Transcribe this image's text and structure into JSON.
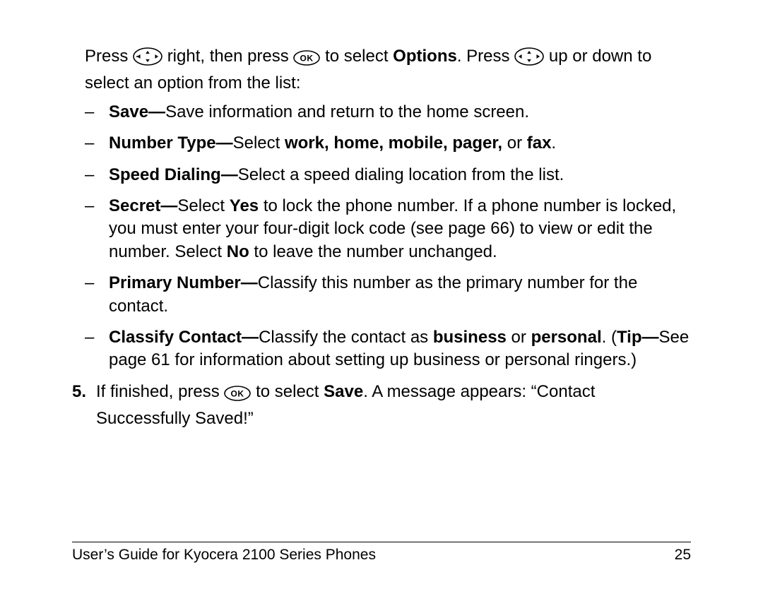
{
  "intro": {
    "p1": "Press ",
    "p2": " right, then press ",
    "p3": " to select ",
    "options": "Options",
    "p4": ". Press ",
    "p5": " up or down to select an option from the list:"
  },
  "bullets": {
    "save": {
      "t": "Save—",
      "d": "Save information and return to the home screen."
    },
    "numtype": {
      "t": "Number Type—",
      "d1": "Select ",
      "d2": "work, home, mobile, pager,",
      "d3": " or ",
      "d4": "fax",
      "d5": "."
    },
    "speed": {
      "t": "Speed Dialing—",
      "d": "Select a speed dialing location from the list."
    },
    "secret": {
      "t": "Secret—",
      "d1": "Select ",
      "yes": "Yes",
      "d2": " to lock the phone number. If a phone number is locked, you must enter your four-digit lock code (see page 66) to view or edit the number. Select ",
      "no": "No",
      "d3": " to leave the number unchanged."
    },
    "primary": {
      "t": "Primary Number—",
      "d": "Classify this number as the primary number for the contact."
    },
    "classify": {
      "t": "Classify Contact—",
      "d1": "Classify the contact as ",
      "biz": "business",
      "d2": " or ",
      "per": "personal",
      "d3": ". (",
      "tip": "Tip—",
      "d4": "See page 61 for information about setting up business or personal ringers.)"
    }
  },
  "step5": {
    "num": "5.",
    "p1": "If finished, press ",
    "p2": " to select ",
    "save": "Save",
    "p3": ". A message appears: “Contact Successfully Saved!”"
  },
  "footer": {
    "title": "User’s Guide for Kyocera 2100 Series Phones",
    "page": "25"
  }
}
